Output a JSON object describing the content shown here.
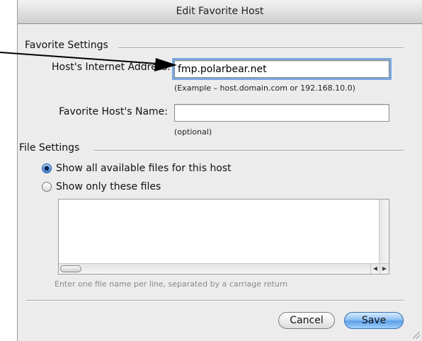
{
  "window": {
    "title": "Edit Favorite Host"
  },
  "favorite_settings": {
    "section_label": "Favorite Settings",
    "address_label": "Host's Internet Address:",
    "address_value": "fmp.polarbear.net",
    "address_hint": "(Example – host.domain.com or 192.168.10.0)",
    "name_label": "Favorite Host's Name:",
    "name_value": "",
    "name_hint": "(optional)"
  },
  "file_settings": {
    "section_label": "File Settings",
    "radio_all": "Show all available files for this host",
    "radio_only": "Show only these files",
    "selected": "all",
    "list_hint": "Enter one file name per line, separated by a carriage return"
  },
  "buttons": {
    "cancel": "Cancel",
    "save": "Save"
  }
}
